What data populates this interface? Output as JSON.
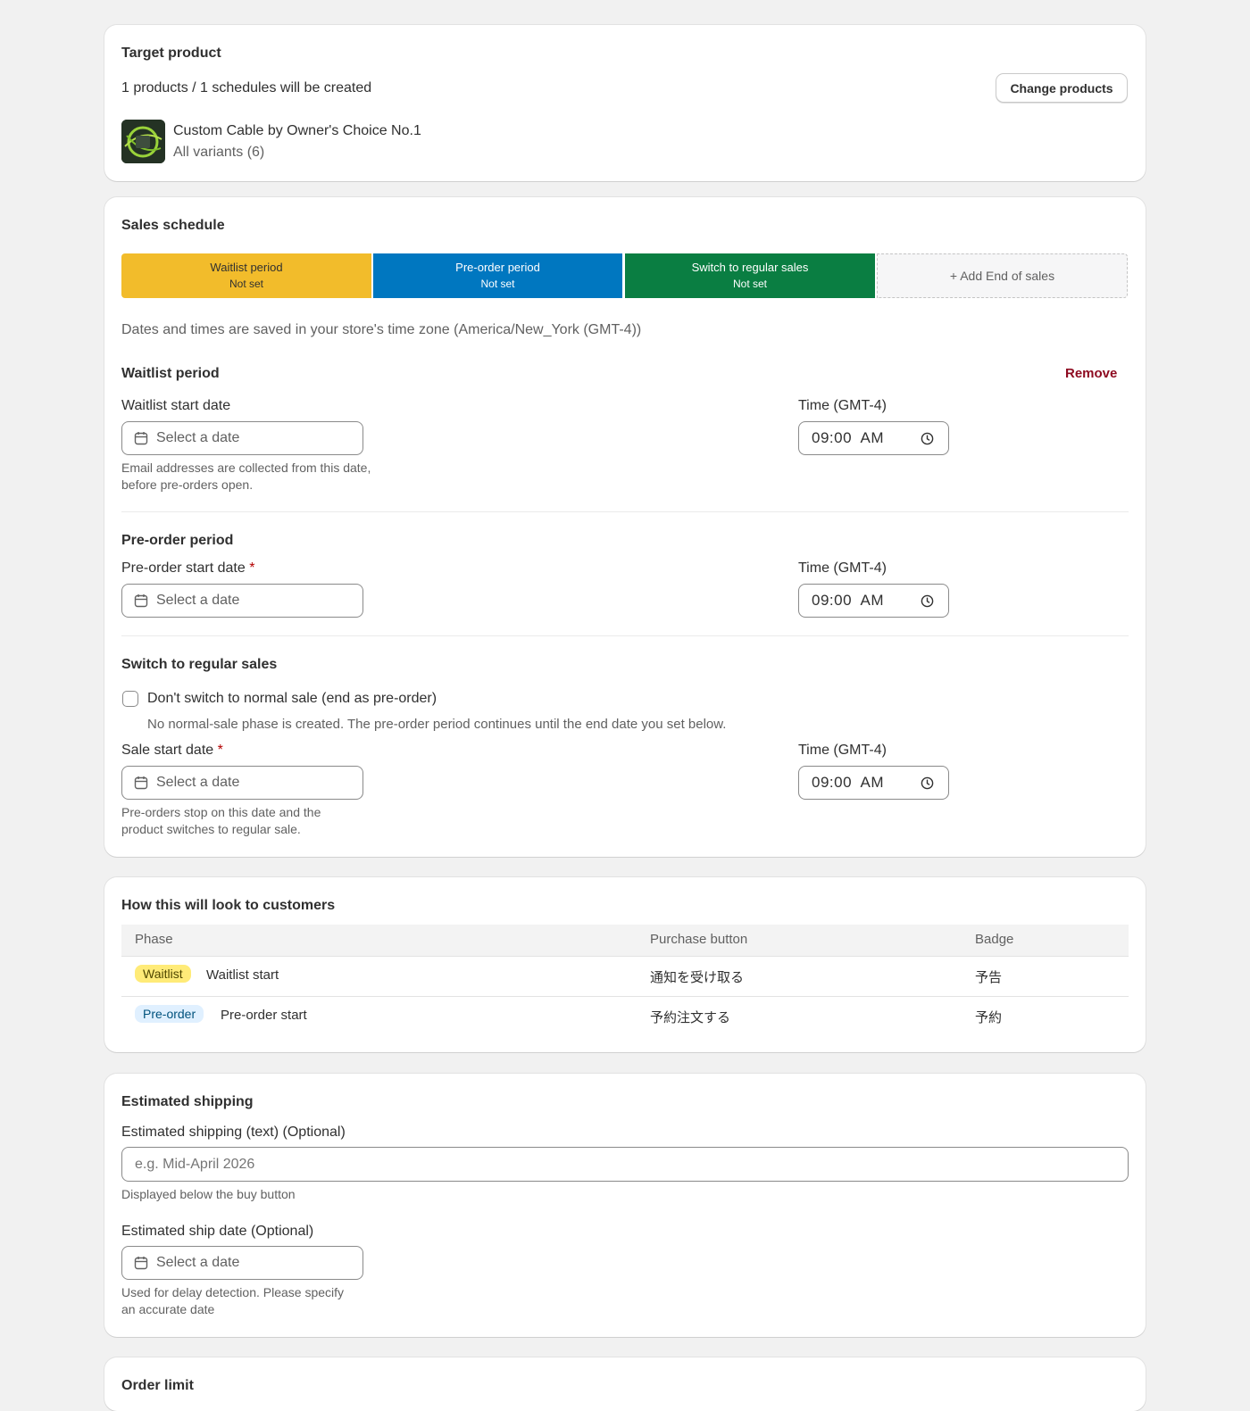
{
  "target": {
    "title": "Target product",
    "summary": "1 products / 1 schedules will be created",
    "change_button": "Change products",
    "product_name": "Custom Cable by Owner's Choice No.1",
    "variants": "All variants (6)"
  },
  "schedule": {
    "title": "Sales schedule",
    "segments": [
      {
        "label": "Waitlist period",
        "status": "Not set",
        "color": "#f2bc2b"
      },
      {
        "label": "Pre-order period",
        "status": "Not set",
        "color": "#0077c0"
      },
      {
        "label": "Switch to regular sales",
        "status": "Not set",
        "color": "#0a7e42"
      }
    ],
    "add_end": "+ Add End of sales",
    "timezone_note": "Dates and times are saved in your store's time zone (America/New_York (GMT-4))",
    "waitlist": {
      "title": "Waitlist period",
      "remove": "Remove",
      "date_label": "Waitlist start date",
      "date_placeholder": "Select a date",
      "time_label": "Time (GMT-4)",
      "time_value": "09:00  AM",
      "help": "Email addresses are collected from this date, before pre-orders open."
    },
    "preorder": {
      "title": "Pre-order period",
      "date_label": "Pre-order start date",
      "required": "*",
      "date_placeholder": "Select a date",
      "time_label": "Time (GMT-4)",
      "time_value": "09:00  AM"
    },
    "regular": {
      "title": "Switch to regular sales",
      "checkbox_label": "Don't switch to normal sale (end as pre-order)",
      "checkbox_help": "No normal-sale phase is created. The pre-order period continues until the end date you set below.",
      "date_label": "Sale start date",
      "required": "*",
      "date_placeholder": "Select a date",
      "time_label": "Time (GMT-4)",
      "time_value": "09:00  AM",
      "help": "Pre-orders stop on this date and the product switches to regular sale."
    }
  },
  "preview": {
    "title": "How this will look to customers",
    "columns": [
      "Phase",
      "Purchase button",
      "Badge"
    ],
    "rows": [
      {
        "pill": "Waitlist",
        "phase": "Waitlist start",
        "button": "通知を受け取る",
        "badge": "予告"
      },
      {
        "pill": "Pre-order",
        "phase": "Pre-order start",
        "button": "予約注文する",
        "badge": "予約"
      }
    ]
  },
  "shipping": {
    "title": "Estimated shipping",
    "text_label": "Estimated shipping (text) (Optional)",
    "text_placeholder": "e.g. Mid-April 2026",
    "text_help": "Displayed below the buy button",
    "date_label": "Estimated ship date (Optional)",
    "date_placeholder": "Select a date",
    "date_help": "Used for delay detection. Please specify an accurate date"
  },
  "order_limit": {
    "title": "Order limit"
  }
}
